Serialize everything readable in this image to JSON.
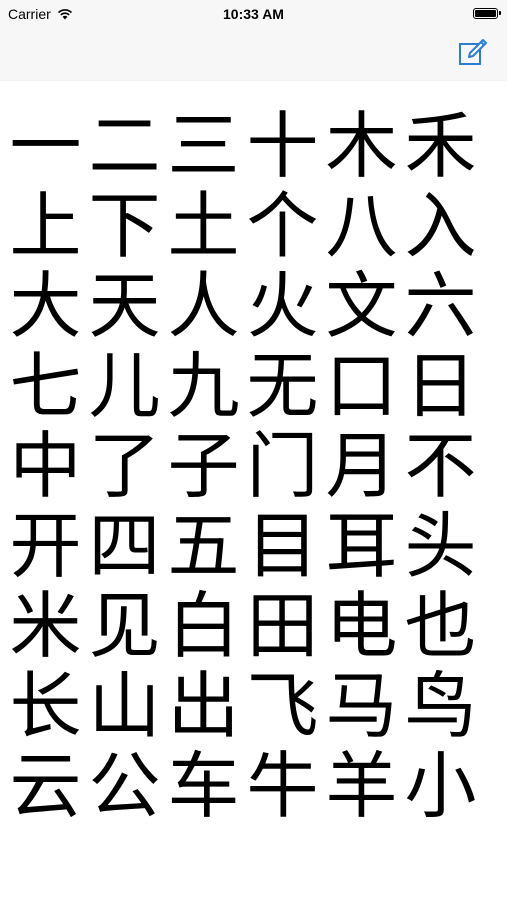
{
  "status_bar": {
    "carrier": "Carrier",
    "time": "10:33 AM"
  },
  "nav_bar": {
    "compose_icon": "compose-icon",
    "accent_color": "#2b7cd3"
  },
  "characters": [
    [
      "一",
      "二",
      "三",
      "十",
      "木",
      "禾"
    ],
    [
      "上",
      "下",
      "土",
      "个",
      "八",
      "入"
    ],
    [
      "大",
      "天",
      "人",
      "火",
      "文",
      "六"
    ],
    [
      "七",
      "儿",
      "九",
      "无",
      "口",
      "日"
    ],
    [
      "中",
      "了",
      "子",
      "门",
      "月",
      "不"
    ],
    [
      "开",
      "四",
      "五",
      "目",
      "耳",
      "头"
    ],
    [
      "米",
      "见",
      "白",
      "田",
      "电",
      "也"
    ],
    [
      "长",
      "山",
      "出",
      "飞",
      "马",
      "鸟"
    ],
    [
      "云",
      "公",
      "车",
      "牛",
      "羊",
      "小"
    ]
  ]
}
